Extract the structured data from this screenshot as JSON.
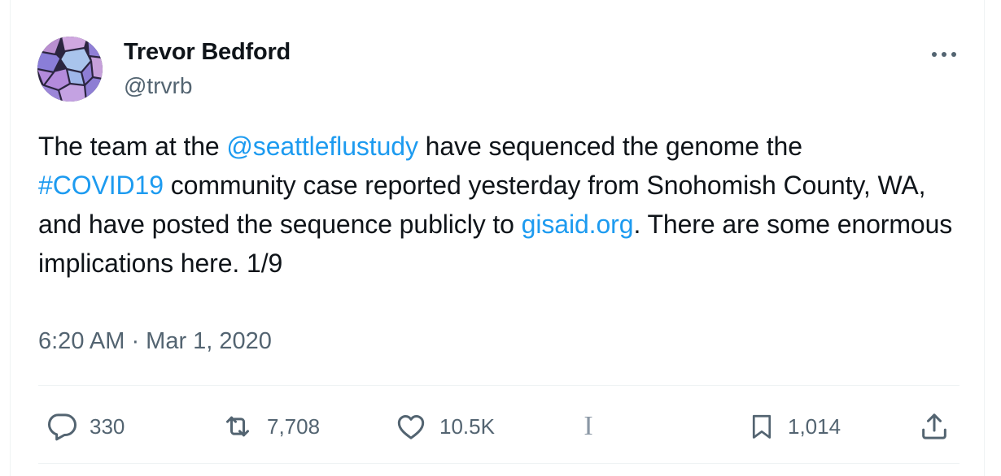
{
  "author": {
    "name": "Trevor Bedford",
    "handle": "@trvrb"
  },
  "tweet": {
    "text_part1": "The team at the ",
    "mention": "@seattleflustudy",
    "text_part2": " have sequenced the genome the ",
    "hashtag": "#COVID19",
    "text_part3": " community case reported yesterday from Snohomish County, WA, and have posted the sequence publicly to ",
    "link": "gisaid.org",
    "text_part4": ". There are some enormous implications here. 1/9"
  },
  "timestamp": "6:20 AM · Mar 1, 2020",
  "actions": {
    "replies": "330",
    "retweets": "7,708",
    "likes": "10.5K",
    "views_glyph": "I",
    "bookmarks": "1,014"
  },
  "icons": {
    "more": "more-icon",
    "reply": "reply-icon",
    "retweet": "retweet-icon",
    "like": "heart-icon",
    "views": "views-icon",
    "bookmark": "bookmark-icon",
    "share": "share-icon"
  },
  "colors": {
    "link": "#1d9bf0",
    "secondary_text": "#536471",
    "primary_text": "#0f1419",
    "divider": "#eff3f4"
  }
}
